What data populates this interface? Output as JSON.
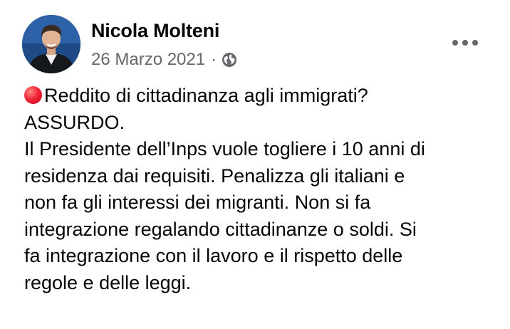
{
  "post": {
    "author_name": "Nicola Molteni",
    "date": "26 Marzo 2021",
    "separator": "·",
    "privacy_icon": "globe-icon",
    "more_icon": "more-options-icon",
    "emoji": "red-circle-emoji",
    "text_lines": [
      "Reddito di cittadinanza agli immigrati?",
      "ASSURDO.",
      "Il Presidente dell’Inps vuole togliere i 10 anni di",
      "residenza dai requisiti. Penalizza gli italiani e",
      "non fa gli interessi dei migranti. Non si fa",
      "integrazione regalando cittadinanze o soldi. Si",
      "fa integrazione con il lavoro e il rispetto delle",
      "regole e delle leggi."
    ]
  },
  "colors": {
    "text_primary": "#050505",
    "text_secondary": "#65676b",
    "emoji_red": "#f2263a"
  }
}
